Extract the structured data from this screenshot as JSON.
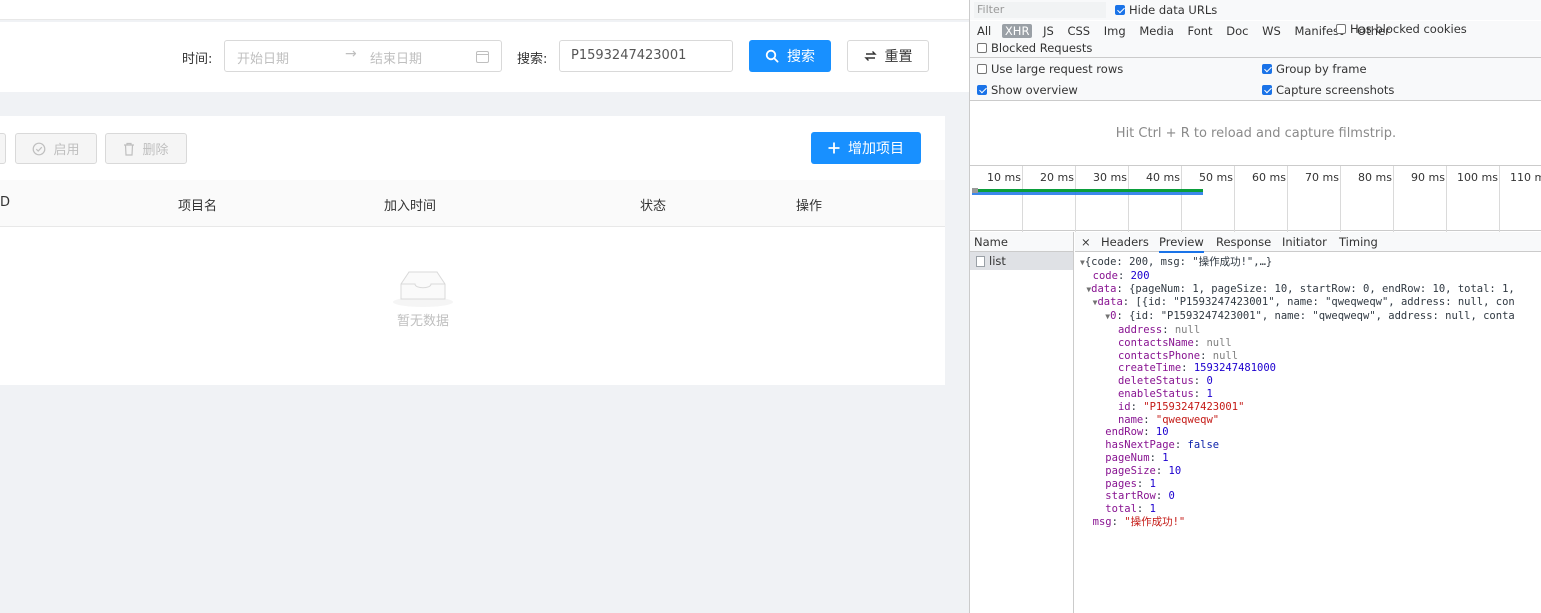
{
  "app": {
    "search": {
      "time_label": "时间:",
      "start_placeholder": "开始日期",
      "end_placeholder": "结束日期",
      "range_arrow": "→",
      "search_label": "搜索:",
      "search_value": "P1593247423001",
      "search_button": "搜索",
      "reset_button": "重置"
    },
    "toolbar": {
      "enable_button": "启用",
      "delete_button": "删除",
      "add_button": "增加项目"
    },
    "table": {
      "columns": [
        "D",
        "项目名",
        "加入时间",
        "状态",
        "操作"
      ],
      "empty_text": "暂无数据"
    }
  },
  "devtools": {
    "filter_placeholder": "Filter",
    "hide_data_urls": "Hide data URLs",
    "types": [
      "All",
      "XHR",
      "JS",
      "CSS",
      "Img",
      "Media",
      "Font",
      "Doc",
      "WS",
      "Manifest",
      "Other"
    ],
    "active_type": "XHR",
    "has_blocked_cookies": "Has blocked cookies",
    "blocked_requests": "Blocked Requests",
    "use_large_rows": "Use large request rows",
    "group_by_frame": "Group by frame",
    "show_overview": "Show overview",
    "capture_screenshots": "Capture screenshots",
    "hint": "Hit Ctrl + R to reload and capture filmstrip.",
    "ticks": [
      "10 ms",
      "20 ms",
      "30 ms",
      "40 ms",
      "50 ms",
      "60 ms",
      "70 ms",
      "80 ms",
      "90 ms",
      "100 ms",
      "110 ms"
    ],
    "name_header": "Name",
    "request_name": "list",
    "close_symbol": "×",
    "tabs": [
      "Headers",
      "Preview",
      "Response",
      "Initiator",
      "Timing"
    ],
    "active_tab": "Preview",
    "preview": {
      "root_summary": "{code: 200, msg: \"操作成功!\",…}",
      "code": "200",
      "data_summary": "{pageNum: 1, pageSize: 10, startRow: 0, endRow: 10, total: 1,",
      "list_summary": "[{id: \"P1593247423001\", name: \"qweqweqw\", address: null, con",
      "item_summary": "{id: \"P1593247423001\", name: \"qweqweqw\", address: null, conta",
      "address": "null",
      "contactsName": "null",
      "contactsPhone": "null",
      "createTime": "1593247481000",
      "deleteStatus": "0",
      "enableStatus": "1",
      "id": "\"P1593247423001\"",
      "name": "\"qweqweqw\"",
      "endRow": "10",
      "hasNextPage": "false",
      "pageNum": "1",
      "pageSize": "10",
      "pages": "1",
      "startRow": "0",
      "total": "1",
      "msg": "\"操作成功!\""
    }
  }
}
